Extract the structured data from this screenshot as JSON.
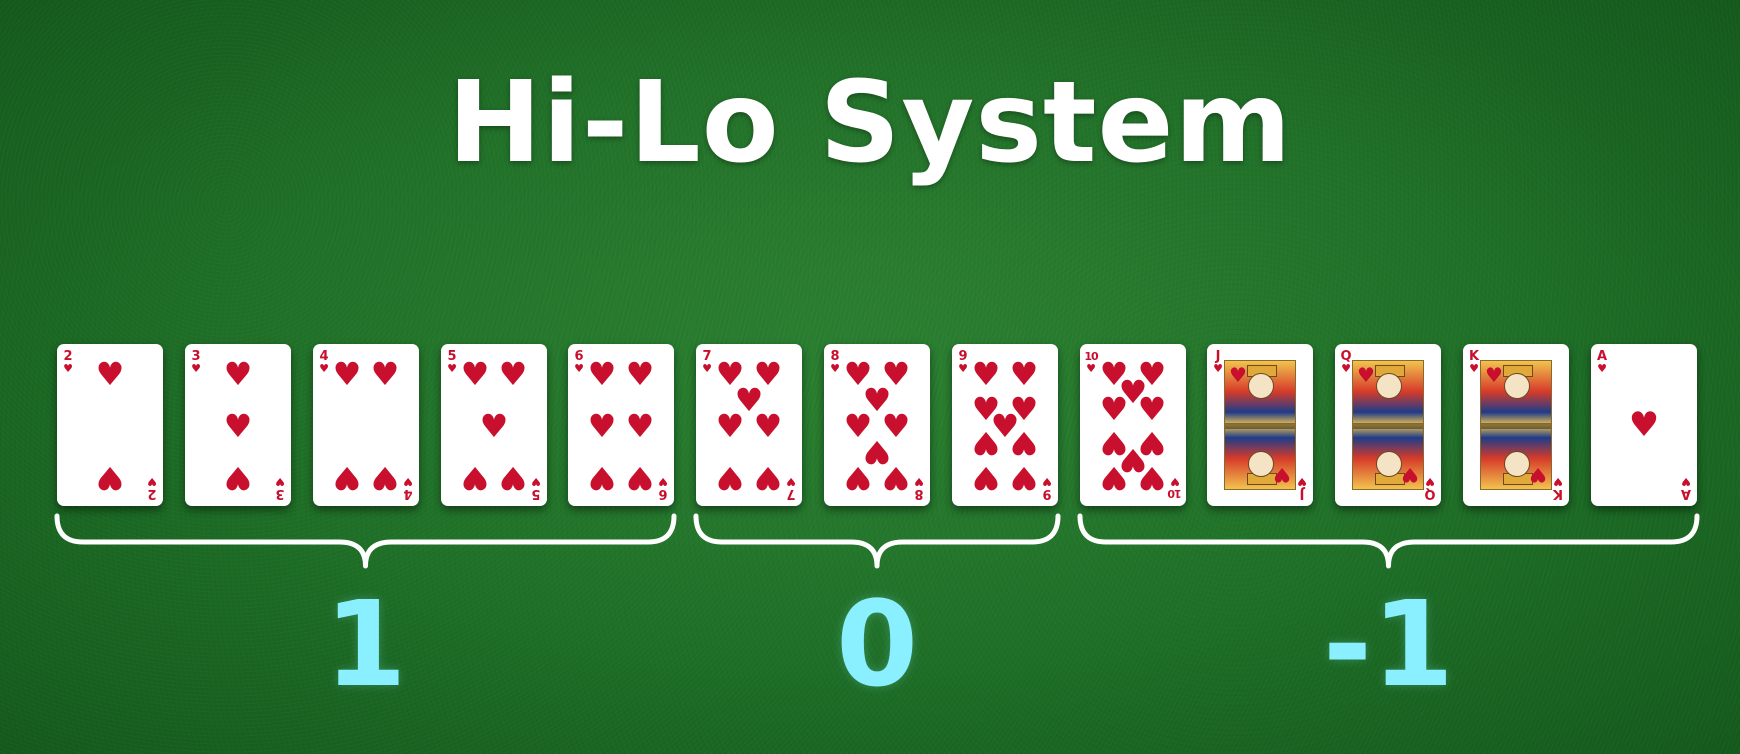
{
  "title": "Hi-Lo System",
  "colors": {
    "felt": "#1d6d26",
    "card": "#ffffff",
    "suit": "#c8102e",
    "value": "#8af0ff",
    "brace": "#ffffff"
  },
  "suit_icon": "heart-icon",
  "cards": [
    {
      "rank": "2",
      "suit": "♥",
      "type": "pips",
      "count": 2
    },
    {
      "rank": "3",
      "suit": "♥",
      "type": "pips",
      "count": 3
    },
    {
      "rank": "4",
      "suit": "♥",
      "type": "pips",
      "count": 4
    },
    {
      "rank": "5",
      "suit": "♥",
      "type": "pips",
      "count": 5
    },
    {
      "rank": "6",
      "suit": "♥",
      "type": "pips",
      "count": 6
    },
    {
      "rank": "7",
      "suit": "♥",
      "type": "pips",
      "count": 7
    },
    {
      "rank": "8",
      "suit": "♥",
      "type": "pips",
      "count": 8
    },
    {
      "rank": "9",
      "suit": "♥",
      "type": "pips",
      "count": 9
    },
    {
      "rank": "10",
      "suit": "♥",
      "type": "pips",
      "count": 10
    },
    {
      "rank": "J",
      "suit": "♥",
      "type": "face"
    },
    {
      "rank": "Q",
      "suit": "♥",
      "type": "face"
    },
    {
      "rank": "K",
      "suit": "♥",
      "type": "face"
    },
    {
      "rank": "A",
      "suit": "♥",
      "type": "ace"
    }
  ],
  "groups": [
    {
      "value": "1",
      "first_card": 0,
      "last_card": 4
    },
    {
      "value": "0",
      "first_card": 5,
      "last_card": 7
    },
    {
      "value": "-1",
      "first_card": 8,
      "last_card": 12
    }
  ]
}
